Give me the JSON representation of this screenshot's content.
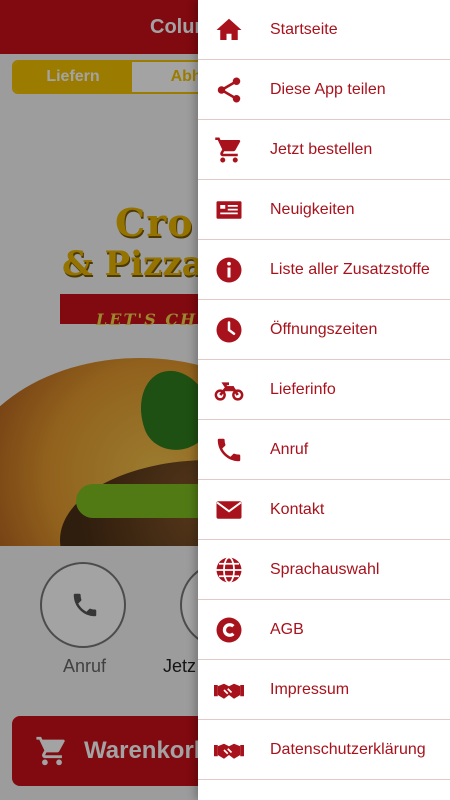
{
  "app": {
    "header_title": "Colum",
    "toggle": {
      "deliver": "Liefern",
      "pickup": "Abho"
    },
    "logo": {
      "line1": "Cro",
      "line2": "& Pizza",
      "tagline": "LET'S CH"
    },
    "call_label": "Anruf",
    "order_label": "Jetz",
    "cart_label": "Warenkorb"
  },
  "drawer": {
    "items": [
      {
        "label": "Startseite",
        "icon": "home-icon"
      },
      {
        "label": "Diese App teilen",
        "icon": "share-icon"
      },
      {
        "label": "Jetzt bestellen",
        "icon": "cart-icon"
      },
      {
        "label": "Neuigkeiten",
        "icon": "newspaper-icon"
      },
      {
        "label": "Liste aller Zusatzstoffe",
        "icon": "info-icon"
      },
      {
        "label": "Öffnungszeiten",
        "icon": "clock-icon"
      },
      {
        "label": "Lieferinfo",
        "icon": "motorcycle-icon"
      },
      {
        "label": "Anruf",
        "icon": "phone-icon"
      },
      {
        "label": "Kontakt",
        "icon": "envelope-icon"
      },
      {
        "label": "Sprachauswahl",
        "icon": "globe-icon"
      },
      {
        "label": "AGB",
        "icon": "copyright-icon"
      },
      {
        "label": "Impressum",
        "icon": "handshake-icon"
      },
      {
        "label": "Datenschutzerklärung",
        "icon": "handshake-icon"
      }
    ]
  },
  "colors": {
    "brand_red": "#c8101a",
    "menu_text": "#a8121c",
    "accent_yellow": "#f2c200",
    "green": "#7fbf22"
  }
}
